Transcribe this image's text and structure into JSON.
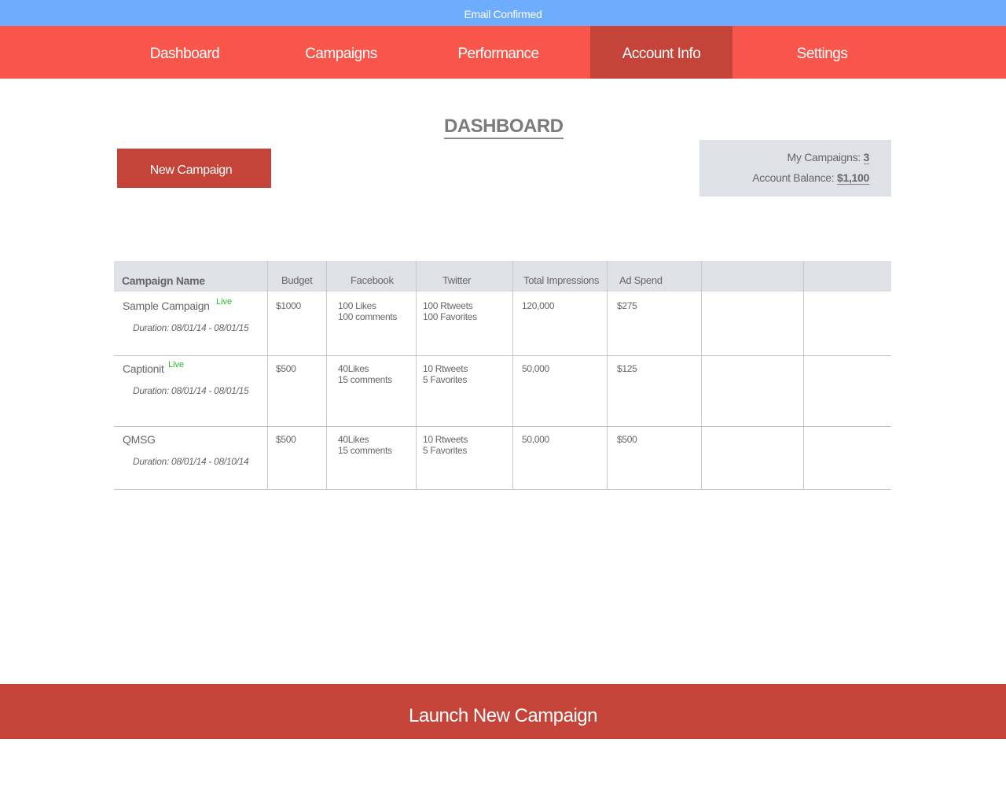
{
  "banner": {
    "text": "Email Confirmed"
  },
  "nav": {
    "items": [
      {
        "label": "Dashboard"
      },
      {
        "label": "Campaigns"
      },
      {
        "label": "Performance"
      },
      {
        "label": "Account Info",
        "active": true
      },
      {
        "label": "Settings"
      }
    ]
  },
  "page": {
    "title": "DASHBOARD"
  },
  "actions": {
    "new_campaign": "New Campaign",
    "launch_new_campaign": "Launch New Campaign"
  },
  "summary": {
    "campaigns_label": "My Campaigns:",
    "campaigns_value": "3",
    "balance_label": "Account Balance:",
    "balance_value": "$1,100"
  },
  "table": {
    "headers": [
      "Campaign Name",
      "Budget",
      "Facebook",
      "Twitter",
      "Total Impressions",
      "Ad Spend",
      "",
      ""
    ],
    "rows": [
      {
        "name": "Sample Campaign",
        "status": "Live",
        "duration": "Duration: 08/01/14 - 08/01/15",
        "budget": "$1000",
        "facebook_line1": "100 Likes",
        "facebook_line2": "100 comments",
        "twitter_line1": "100 Rtweets",
        "twitter_line2": "100 Favorites",
        "impressions": "120,000",
        "ad_spend": "$275"
      },
      {
        "name": "Captionit",
        "status": "Live",
        "duration": "Duration: 08/01/14 - 08/01/15",
        "budget": "$500",
        "facebook_line1": "40Likes",
        "facebook_line2": "15 comments",
        "twitter_line1": "10 Rtweets",
        "twitter_line2": "5 Favorites",
        "impressions": "50,000",
        "ad_spend": "$125"
      },
      {
        "name": "QMSG",
        "status": "",
        "duration": "Duration: 08/01/14 - 08/10/14",
        "budget": "$500",
        "facebook_line1": "40Likes",
        "facebook_line2": "15 comments",
        "twitter_line1": "10 Rtweets",
        "twitter_line2": "5 Favorites",
        "impressions": "50,000",
        "ad_spend": "$500"
      }
    ]
  },
  "colors": {
    "banner": "#6eadfe",
    "nav": "#f8564a",
    "nav_active": "#c5443a",
    "primary_button": "#c5443a",
    "panel": "#dee1e6",
    "live": "#22c22a"
  }
}
